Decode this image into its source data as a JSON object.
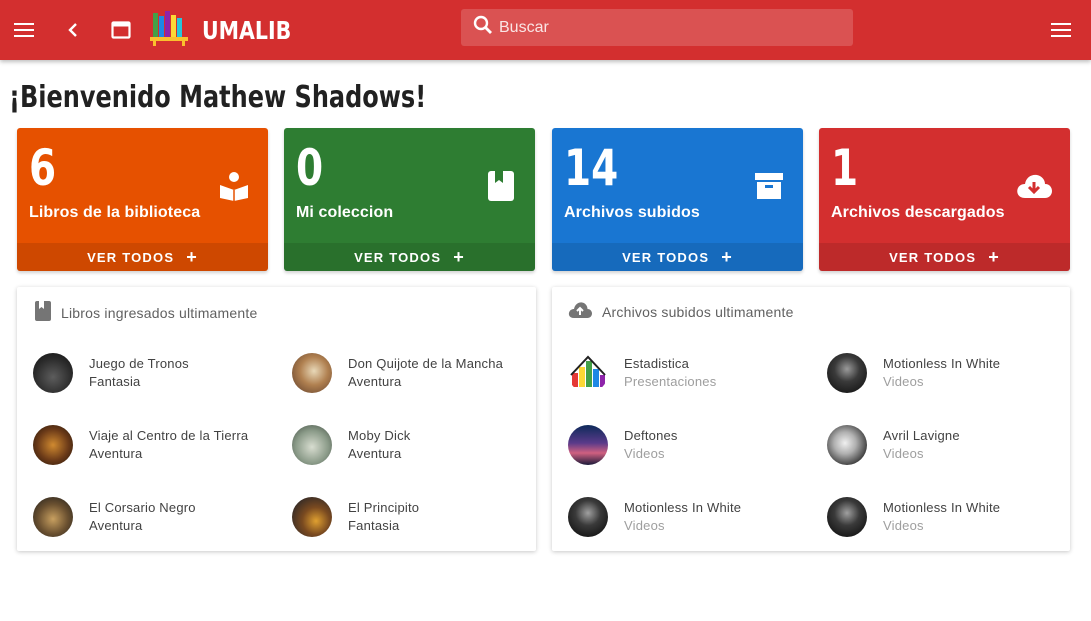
{
  "colors": {
    "appbar": "#d32f2f",
    "orange": "#e65100",
    "green": "#2e7d32",
    "blue": "#1976d2",
    "red": "#d32f2f"
  },
  "appbar": {
    "brand": "UMALIB",
    "search_placeholder": "Buscar",
    "icons": [
      "menu-icon",
      "back-icon",
      "window-icon",
      "books-logo-icon",
      "search-icon",
      "menu-icon"
    ]
  },
  "welcome": "¡Bienvenido Mathew Shadows!",
  "stats": [
    {
      "count": "6",
      "label": "Libros de la biblioteca",
      "action": "VER TODOS",
      "icon": "book-reader-icon"
    },
    {
      "count": "0",
      "label": "Mi coleccion",
      "action": "VER TODOS",
      "icon": "bookmark-book-icon"
    },
    {
      "count": "14",
      "label": "Archivos subidos",
      "action": "VER TODOS",
      "icon": "archive-icon"
    },
    {
      "count": "1",
      "label": "Archivos descargados",
      "action": "VER TODOS",
      "icon": "cloud-download-icon"
    }
  ],
  "books_panel": {
    "title": "Libros ingresados ultimamente",
    "icon": "book-icon",
    "items": [
      {
        "name": "Juego de Tronos",
        "sub": "Fantasia"
      },
      {
        "name": "Don Quijote de la Mancha",
        "sub": "Aventura"
      },
      {
        "name": "Viaje al Centro de la Tierra",
        "sub": "Aventura"
      },
      {
        "name": "Moby Dick",
        "sub": "Aventura"
      },
      {
        "name": "El Corsario Negro",
        "sub": "Aventura"
      },
      {
        "name": "El Principito",
        "sub": "Fantasia"
      }
    ]
  },
  "files_panel": {
    "title": "Archivos subidos ultimamente",
    "icon": "cloud-upload-icon",
    "items": [
      {
        "name": "Estadistica",
        "sub": "Presentaciones"
      },
      {
        "name": "Motionless In White",
        "sub": "Videos"
      },
      {
        "name": "Deftones",
        "sub": "Videos"
      },
      {
        "name": "Avril Lavigne",
        "sub": "Videos"
      },
      {
        "name": "Motionless In White",
        "sub": "Videos"
      },
      {
        "name": "Motionless In White",
        "sub": "Videos"
      }
    ]
  }
}
